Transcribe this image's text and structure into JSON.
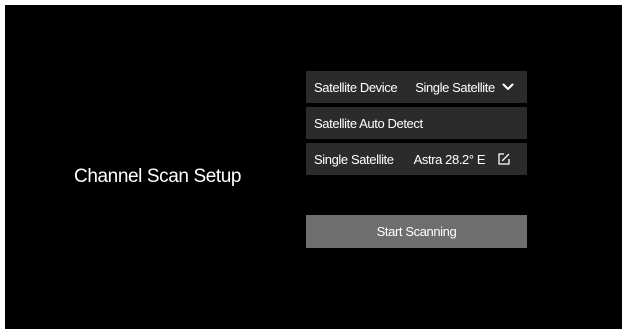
{
  "screen": {
    "title": "Channel Scan Setup"
  },
  "settings": {
    "satellite_device": {
      "label": "Satellite Device",
      "value": "Single Satellite",
      "icon": "chevron-down-icon"
    },
    "auto_detect": {
      "label": "Satellite Auto Detect"
    },
    "single_satellite": {
      "label": "Single Satellite",
      "value": "Astra 28.2° E",
      "icon": "edit-icon"
    }
  },
  "actions": {
    "start_scanning_label": "Start Scanning"
  },
  "colors": {
    "background": "#000000",
    "row_background": "#2b2b2b",
    "button_background": "#6e6e6e",
    "text": "#ffffff"
  }
}
